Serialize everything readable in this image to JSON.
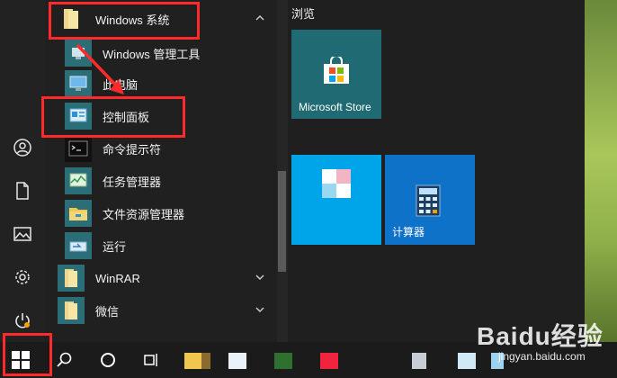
{
  "tiles_header": "浏览",
  "store_tile": {
    "label": "Microsoft Store",
    "color": "#206a74"
  },
  "tile_blue": {
    "color": "#00a4e8"
  },
  "calculator_tile": {
    "label": "计算器",
    "color": "#0f72c9"
  },
  "app_list": [
    {
      "label": "Windows 系统",
      "icon": "folder-icon",
      "type": "group-expanded"
    },
    {
      "label": "Windows 管理工具",
      "icon": "admin-tools-icon",
      "type": "app"
    },
    {
      "label": "此电脑",
      "icon": "computer-icon",
      "type": "app"
    },
    {
      "label": "控制面板",
      "icon": "control-panel-icon",
      "type": "app"
    },
    {
      "label": "命令提示符",
      "icon": "cmd-icon",
      "type": "app"
    },
    {
      "label": "任务管理器",
      "icon": "task-manager-icon",
      "type": "app"
    },
    {
      "label": "文件资源管理器",
      "icon": "explorer-icon",
      "type": "app"
    },
    {
      "label": "运行",
      "icon": "run-icon",
      "type": "app"
    },
    {
      "label": "WinRAR",
      "icon": "folder-icon",
      "type": "group-collapsed"
    },
    {
      "label": "微信",
      "icon": "folder-icon",
      "type": "group-collapsed"
    }
  ],
  "watermark": {
    "brand": "Baidu经验",
    "url": "jingyan.baidu.com"
  },
  "accent": {
    "red": "#ff2a2a",
    "taskbar": "#1b1b1b"
  }
}
